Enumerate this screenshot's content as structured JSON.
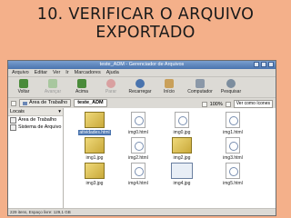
{
  "title_line1": "10. VERIFICAR O ARQUIVO",
  "title_line2": "EXPORTADO",
  "window": {
    "title": "teste_ADM - Gerenciador de Arquivos"
  },
  "menu": [
    "Arquivo",
    "Editar",
    "Ver",
    "Ir",
    "Marcadores",
    "Ajuda"
  ],
  "toolbar": {
    "back": "Voltar",
    "forward": "Avançar",
    "up": "Acima",
    "stop": "Parar",
    "reload": "Recarregar",
    "home": "Início",
    "computer": "Computador",
    "search": "Pesquisar"
  },
  "location": {
    "path1": "Área de Trabalho",
    "path2": "teste_ADM",
    "zoom": "100%",
    "view": "Ver como ícones"
  },
  "sidebar": {
    "header": "Locais",
    "items": [
      "Área de Trabalho",
      "Sistema de Arquivo"
    ]
  },
  "files": [
    {
      "name": "atividades.html",
      "kind": "img"
    },
    {
      "name": "img0.html",
      "kind": "html"
    },
    {
      "name": "img0.jpg",
      "kind": "html"
    },
    {
      "name": "img1.html",
      "kind": "html"
    },
    {
      "name": "img1.jpg",
      "kind": "img"
    },
    {
      "name": "img2.html",
      "kind": "html"
    },
    {
      "name": "img2.jpg",
      "kind": "img"
    },
    {
      "name": "img3.html",
      "kind": "html"
    },
    {
      "name": "img3.jpg",
      "kind": "img"
    },
    {
      "name": "img4.html",
      "kind": "html"
    },
    {
      "name": "img4.jpg",
      "kind": "shot"
    },
    {
      "name": "img5.html",
      "kind": "html"
    }
  ],
  "status": "229 itens, Espaço livre: 129,1 GB"
}
